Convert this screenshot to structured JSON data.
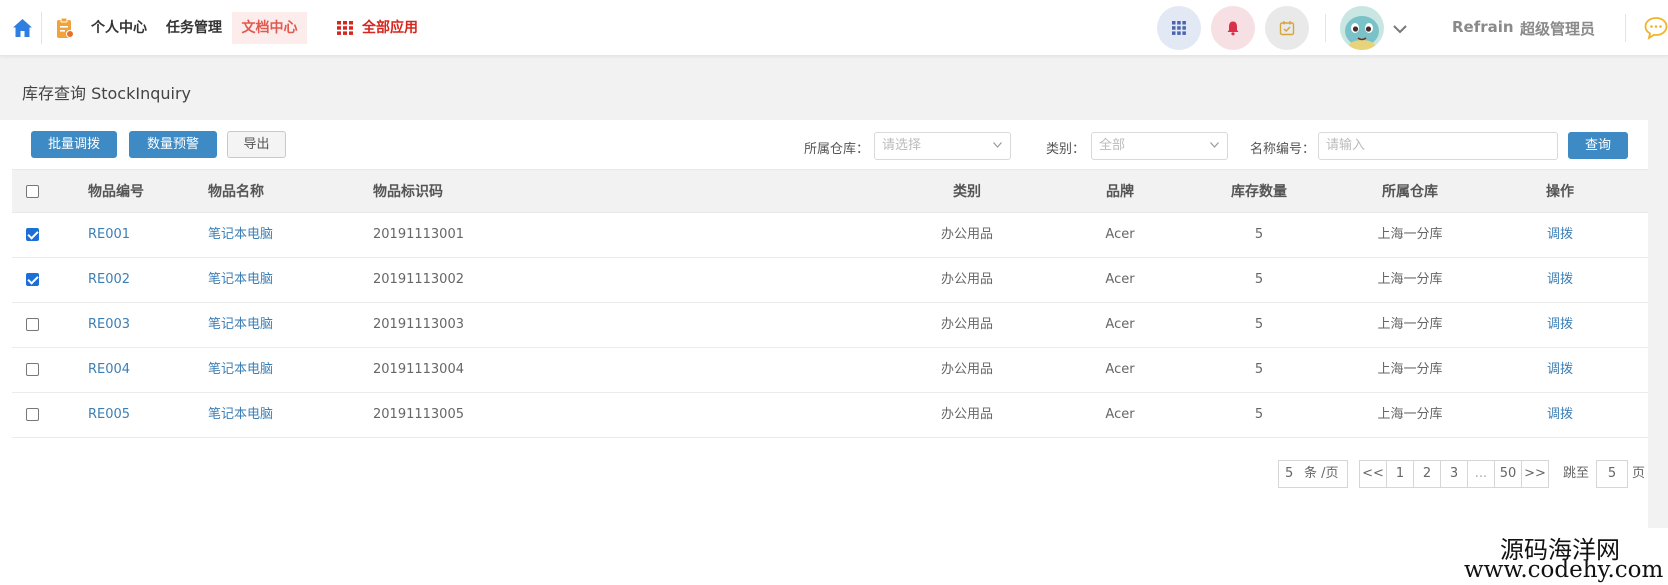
{
  "nav": {
    "items": [
      "个人中心",
      "任务管理",
      "文档中心"
    ],
    "all_apps": "全部应用",
    "user_name": "Refrain",
    "user_role": "超级管理员"
  },
  "page": {
    "title": "库存查询 StockInquiry"
  },
  "toolbar": {
    "batch_transfer": "批量调拨",
    "qty_alert": "数量预警",
    "export": "导出"
  },
  "filters": {
    "warehouse_label": "所属仓库：",
    "warehouse_placeholder": "请选择",
    "category_label": "类别：",
    "category_value": "全部",
    "code_label": "名称编号：",
    "code_placeholder": "请输入",
    "query": "查询"
  },
  "table": {
    "headers": [
      "物品编号",
      "物品名称",
      "物品标识码",
      "类别",
      "品牌",
      "库存数量",
      "所属仓库",
      "操作"
    ],
    "rows": [
      {
        "checked": true,
        "code": "RE001",
        "name": "笔记本电脑",
        "id": "20191113001",
        "cat": "办公用品",
        "brand": "Acer",
        "qty": "5",
        "wh": "上海一分库",
        "action": "调拨"
      },
      {
        "checked": true,
        "code": "RE002",
        "name": "笔记本电脑",
        "id": "20191113002",
        "cat": "办公用品",
        "brand": "Acer",
        "qty": "5",
        "wh": "上海一分库",
        "action": "调拨"
      },
      {
        "checked": false,
        "code": "RE003",
        "name": "笔记本电脑",
        "id": "20191113003",
        "cat": "办公用品",
        "brand": "Acer",
        "qty": "5",
        "wh": "上海一分库",
        "action": "调拨"
      },
      {
        "checked": false,
        "code": "RE004",
        "name": "笔记本电脑",
        "id": "20191113004",
        "cat": "办公用品",
        "brand": "Acer",
        "qty": "5",
        "wh": "上海一分库",
        "action": "调拨"
      },
      {
        "checked": false,
        "code": "RE005",
        "name": "笔记本电脑",
        "id": "20191113005",
        "cat": "办公用品",
        "brand": "Acer",
        "qty": "5",
        "wh": "上海一分库",
        "action": "调拨"
      }
    ]
  },
  "pagination": {
    "page_size": "5",
    "page_size_unit": "条 /页",
    "first": "<<",
    "pages": [
      "1",
      "2",
      "3",
      "...",
      "50"
    ],
    "last": ">>",
    "jump_label": "跳至",
    "jump_value": "5",
    "jump_unit": "页"
  },
  "watermark": {
    "line1": "源码海洋网",
    "line2": "www.codehy.com"
  },
  "colors": {
    "primary": "#3d8ac4",
    "accent_red": "#d7261e",
    "link": "#3d7fb5"
  }
}
